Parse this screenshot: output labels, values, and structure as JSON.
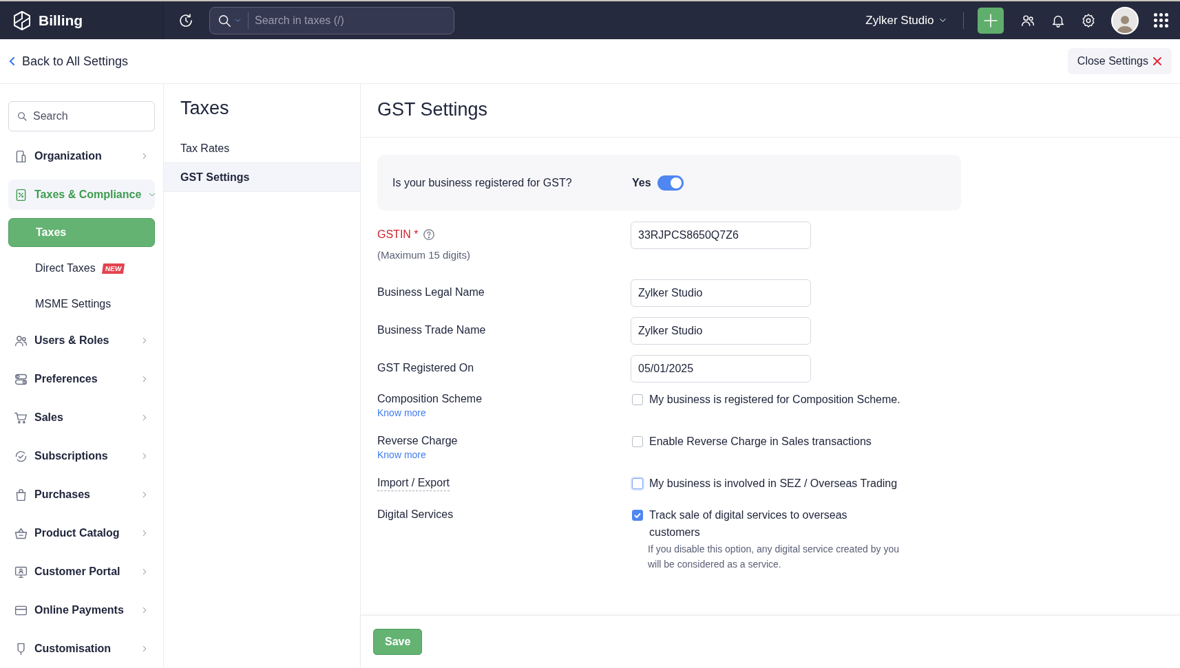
{
  "topbar": {
    "app_name": "Billing",
    "search": {
      "placeholder": "Search in taxes (/)"
    },
    "org_name": "Zylker Studio"
  },
  "header": {
    "back_link": "Back to All Settings",
    "close_button": "Close Settings"
  },
  "sidebar": {
    "search": {
      "placeholder": "Search"
    },
    "items": [
      {
        "label": "Organization",
        "selected": false,
        "expanded": false
      },
      {
        "label": "Taxes & Compliance",
        "selected": true,
        "expanded": true,
        "children": [
          {
            "label": "Taxes",
            "selected": true
          },
          {
            "label": "Direct Taxes",
            "badge": "NEW",
            "selected": false
          },
          {
            "label": "MSME Settings",
            "selected": false
          }
        ]
      },
      {
        "label": "Users & Roles",
        "selected": false,
        "expanded": false
      },
      {
        "label": "Preferences",
        "selected": false,
        "expanded": false
      },
      {
        "label": "Sales",
        "selected": false,
        "expanded": false
      },
      {
        "label": "Subscriptions",
        "selected": false,
        "expanded": false
      },
      {
        "label": "Purchases",
        "selected": false,
        "expanded": false
      },
      {
        "label": "Product Catalog",
        "selected": false,
        "expanded": false
      },
      {
        "label": "Customer Portal",
        "selected": false,
        "expanded": false
      },
      {
        "label": "Online Payments",
        "selected": false,
        "expanded": false
      },
      {
        "label": "Customisation",
        "selected": false,
        "expanded": false
      }
    ]
  },
  "subpanel": {
    "title": "Taxes",
    "items": [
      {
        "label": "Tax Rates",
        "selected": false
      },
      {
        "label": "GST Settings",
        "selected": true
      }
    ]
  },
  "main": {
    "title": "GST Settings",
    "gst_registered": {
      "question": "Is your business registered for GST?",
      "answer": "Yes",
      "on": true
    },
    "rows": [
      {
        "kind": "input",
        "label": "GSTIN",
        "required_mark": "*",
        "hint": "(Maximum 15 digits)",
        "value": "33RJPCS8650Q7Z6"
      },
      {
        "kind": "input",
        "label": "Business Legal Name",
        "value": "Zylker Studio"
      },
      {
        "kind": "input",
        "label": "Business Trade Name",
        "value": "Zylker Studio"
      },
      {
        "kind": "input",
        "label": "GST Registered On",
        "value": "05/01/2025"
      },
      {
        "kind": "checkbox",
        "label": "Composition Scheme",
        "link": "Know more",
        "option": "My business is registered for Composition Scheme.",
        "checked": false,
        "focused": false
      },
      {
        "kind": "checkbox",
        "label": "Reverse Charge",
        "link": "Know more",
        "option": "Enable Reverse Charge in Sales transactions",
        "checked": false,
        "focused": false
      },
      {
        "kind": "checkbox",
        "label": "Import / Export",
        "option": "My business is involved in SEZ / Overseas Trading",
        "checked": false,
        "focused": true
      },
      {
        "kind": "checkbox",
        "label": "Digital Services",
        "option": "Track sale of digital services to overseas customers",
        "note": "If you disable this option, any digital service created by you will be considered as a service.",
        "checked": true,
        "focused": false
      }
    ],
    "save_button": "Save"
  }
}
